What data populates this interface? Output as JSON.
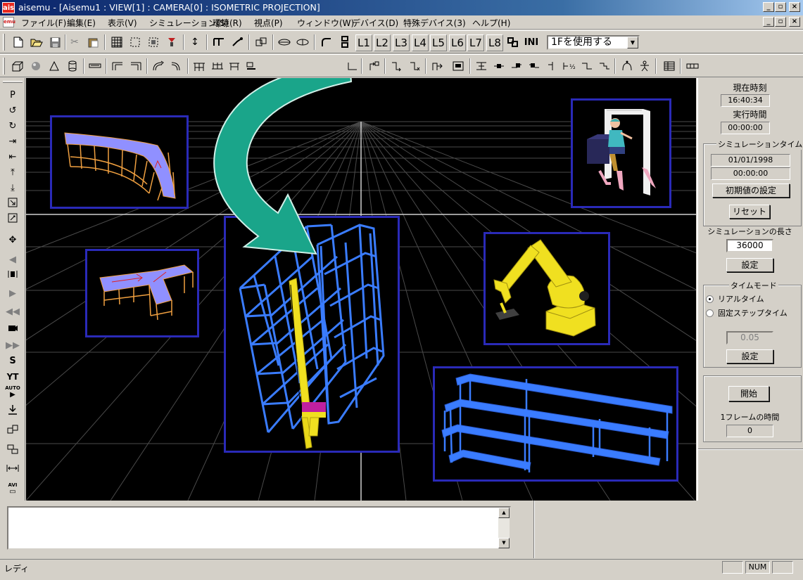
{
  "window": {
    "app_icon": "ais",
    "title": "aisemu - [Aisemu1 : VIEW[1] : CAMERA[0] : ISOMETRIC PROJECTION]",
    "controls": [
      "_",
      "▫",
      "×"
    ]
  },
  "menubar": {
    "icon": "emu",
    "items": [
      "ファイル(F)",
      "編集(E)",
      "表示(V)",
      "シミュレーション(S)",
      "環境(R)",
      "視点(P)",
      "ウィンドウ(W)",
      "デバイス(D)",
      "特殊デバイス(3)",
      "ヘルプ(H)"
    ]
  },
  "toolbar1": {
    "levels": [
      "L1",
      "L2",
      "L3",
      "L4",
      "L5",
      "L6",
      "L7",
      "L8"
    ],
    "ini_label": "INI",
    "floor_select": "1Fを使用する"
  },
  "lefttoolbar": {
    "p_label": "P",
    "s_label": "S",
    "yt_label": "YT",
    "auto_label": "AUTO",
    "avi_label": "AVI"
  },
  "rightpanel": {
    "current_time_label": "現在時刻",
    "current_time": "16:40:34",
    "run_time_label": "実行時間",
    "run_time": "00:00:00",
    "sim_time_group": "シミュレーションタイム",
    "sim_date": "01/01/1998",
    "sim_time": "00:00:00",
    "init_button": "初期値の設定",
    "reset_button": "リセット",
    "sim_length_label": "シミュレーションの長さ",
    "sim_length": "36000",
    "set_button": "設定",
    "time_mode_group": "タイムモード",
    "realtime_label": "リアルタイム",
    "fixed_step_label": "固定ステップタイム",
    "step_value": "0.05",
    "set_button2": "設定",
    "start_button": "開始",
    "frame_time_label": "1フレームの時間",
    "frame_time": "0"
  },
  "statusbar": {
    "text": "レディ",
    "num": "NUM"
  },
  "colors": {
    "panel_border": "#2a2ab8",
    "rack_blue": "#3a7cff",
    "crane_yellow": "#f0e020",
    "arrow_teal": "#1aa58a",
    "conveyor_top": "#9090ff",
    "frame_orange": "#f0a040"
  }
}
